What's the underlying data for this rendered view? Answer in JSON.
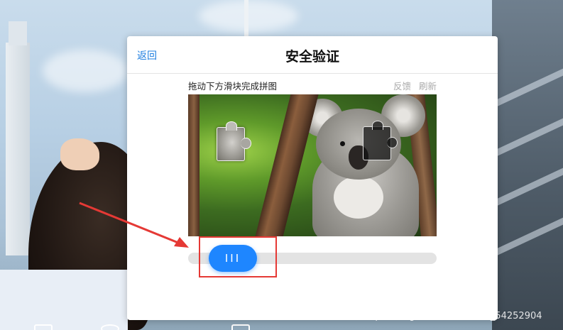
{
  "dialog": {
    "back_label": "返回",
    "title": "安全验证",
    "instruction": "拖动下方滑块完成拼图",
    "feedback_label": "反馈",
    "refresh_label": "刷新"
  },
  "slider": {
    "grip_glyph": "III",
    "handle_color": "#1e86ff"
  },
  "annotation": {
    "highlight_color": "#e53935"
  },
  "watermark": "https://blog.csdn.net/weixin_54252904"
}
